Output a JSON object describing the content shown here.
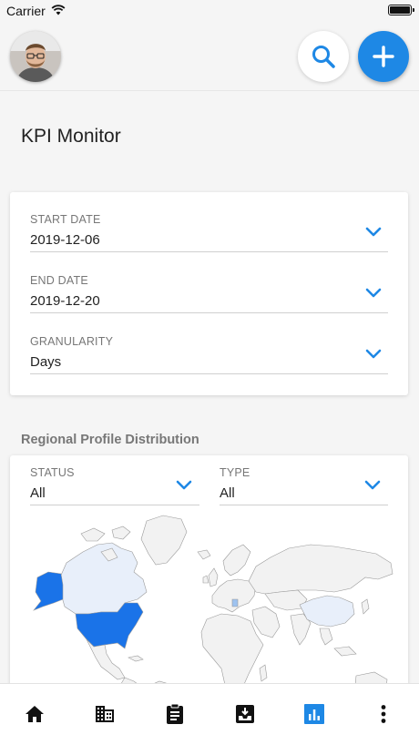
{
  "status_bar": {
    "carrier": "Carrier"
  },
  "header": {
    "avatar_icon": "user-avatar",
    "search_icon": "search-icon",
    "add_icon": "plus-icon",
    "accent": "#1e88e5"
  },
  "page": {
    "title": "KPI Monitor"
  },
  "filters": {
    "start_date": {
      "label": "START DATE",
      "value": "2019-12-06"
    },
    "end_date": {
      "label": "END DATE",
      "value": "2019-12-20"
    },
    "granularity": {
      "label": "GRANULARITY",
      "value": "Days"
    }
  },
  "regional": {
    "title": "Regional Profile Distribution",
    "status": {
      "label": "STATUS",
      "value": "All"
    },
    "type": {
      "label": "TYPE",
      "value": "All"
    },
    "map_colors": {
      "high": "#1a73e8",
      "medium": "#9ec3f0",
      "low": "#e8effa",
      "none": "#f2f2f2"
    }
  },
  "bottom_nav": {
    "items": [
      "home-icon",
      "business-icon",
      "clipboard-icon",
      "inbox-download-icon",
      "chart-icon",
      "more-vert-icon"
    ],
    "active": "chart-icon"
  }
}
